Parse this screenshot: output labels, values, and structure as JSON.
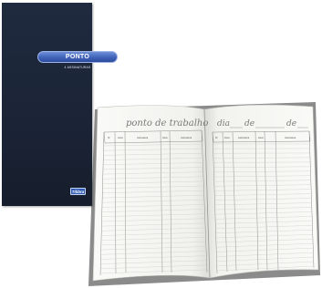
{
  "cover": {
    "title": "PONTO",
    "subtitle": "4 ASSINATURAS",
    "brand": "Tilibra",
    "colors": {
      "cover": "#1b2436",
      "pill": "#3f62b8",
      "badge": "#2f5bb5"
    }
  },
  "open_book": {
    "header_title": "ponto de trabalho",
    "date_words": [
      "dia",
      "de",
      "de"
    ],
    "left_page_columns": [
      "Nº",
      "Hora",
      "Assinatura",
      "Hora",
      "Assinatura"
    ],
    "right_page_columns": [
      "Nº",
      "Hora",
      "Assinatura",
      "Hora",
      "Assinatura"
    ],
    "colors": {
      "paper": "#f4f4f2",
      "rule": "#8b8b8b"
    }
  }
}
